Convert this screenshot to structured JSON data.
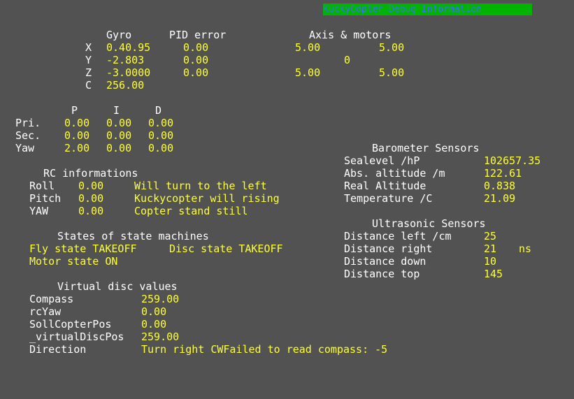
{
  "header": {
    "title": "KuckyCopter Debug Information"
  },
  "imu": {
    "headers": {
      "gyro": "Gyro",
      "pid_error": "PID error",
      "axis_motors": "Axis & motors"
    },
    "rows": [
      {
        "label": "X",
        "gyro": "0.40.95",
        "pid": "0.00",
        "motor_a": "5.00",
        "motor_b": "5.00"
      },
      {
        "label": "Y",
        "gyro": "-2.803",
        "pid": "0.00",
        "motor_mid": "0"
      },
      {
        "label": "Z",
        "gyro": "-3.0000",
        "pid": "0.00",
        "motor_a": "5.00",
        "motor_b": "5.00"
      },
      {
        "label": "C",
        "gyro": "256.00"
      }
    ]
  },
  "pid": {
    "headers": {
      "p": "P",
      "i": "I",
      "d": "D"
    },
    "rows": [
      {
        "label": "Pri.",
        "p": "0.00",
        "i": "0.00",
        "d": "0.00"
      },
      {
        "label": "Sec.",
        "p": "0.00",
        "i": "0.00",
        "d": "0.00"
      },
      {
        "label": "Yaw",
        "p": "2.00",
        "i": "0.00",
        "d": "0.00"
      }
    ]
  },
  "rc": {
    "title": "RC informations",
    "rows": [
      {
        "label": "Roll",
        "value": "0.00",
        "desc": "Will turn to the left"
      },
      {
        "label": "Pitch",
        "value": "0.00",
        "desc": "Kuckycopter will rising"
      },
      {
        "label": "YAW",
        "value": "0.00",
        "desc": "Copter stand still"
      }
    ]
  },
  "states": {
    "title": "States of state machines",
    "fly": "Fly state TAKEOFF",
    "disc": "Disc state TAKEOFF",
    "motor": "Motor state ON"
  },
  "virtual_disc": {
    "title": "Virtual disc values",
    "rows": [
      {
        "label": "Compass",
        "value": "259.00"
      },
      {
        "label": "rcYaw",
        "value": "0.00"
      },
      {
        "label": "SollCopterPos",
        "value": "0.00"
      },
      {
        "label": "_virtualDiscPos",
        "value": "259.00"
      },
      {
        "label": "Direction",
        "value": "Turn right CWFailed to read compass: -5"
      }
    ]
  },
  "barometer": {
    "title": "Barometer Sensors",
    "rows": [
      {
        "label": "Sealevel /hP",
        "value": "102657.35"
      },
      {
        "label": "Abs. altitude /m",
        "value": "122.61"
      },
      {
        "label": "Real Altitude",
        "value": "0.838"
      },
      {
        "label": "Temperature /C",
        "value": "21.09"
      }
    ]
  },
  "ultrasonic": {
    "title": "Ultrasonic Sensors",
    "rows": [
      {
        "label": "Distance left /cm",
        "value": "25"
      },
      {
        "label": "Distance right",
        "value": "21",
        "unit": "ns"
      },
      {
        "label": "Distance down",
        "value": "10"
      },
      {
        "label": "Distance top",
        "value": "145"
      }
    ]
  }
}
